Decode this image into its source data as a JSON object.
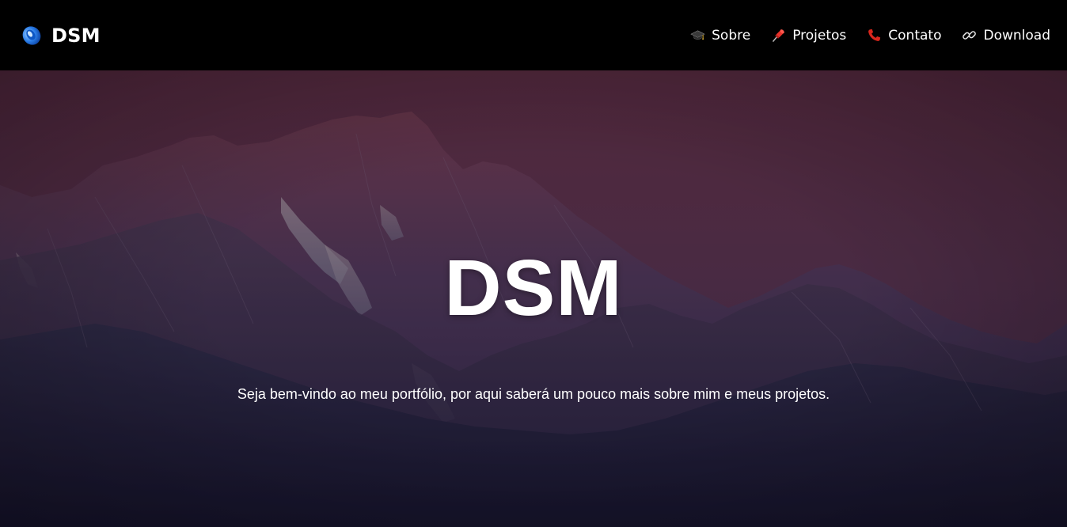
{
  "navbar": {
    "brand": {
      "name": "DSM",
      "logo_icon": "blue-orb-logo-icon"
    },
    "links": [
      {
        "label": "Sobre",
        "icon": "graduation-cap-icon"
      },
      {
        "label": "Projetos",
        "icon": "pushpin-icon"
      },
      {
        "label": "Contato",
        "icon": "telephone-receiver-icon"
      },
      {
        "label": "Download",
        "icon": "link-icon"
      }
    ]
  },
  "hero": {
    "title": "DSM",
    "subtitle": "Seja bem-vindo ao meu portfólio, por aqui saberá um pouco mais sobre mim e meus projetos.",
    "background": "purple-mountain-landscape-image"
  },
  "colors": {
    "navbar_bg": "#000000",
    "text": "#ffffff",
    "sky_top": "#5e2f41",
    "mountain_dark": "#1f1c33",
    "logo_blue": "#2a7de8",
    "pin_red": "#e8322b",
    "phone_red": "#d9261c"
  }
}
